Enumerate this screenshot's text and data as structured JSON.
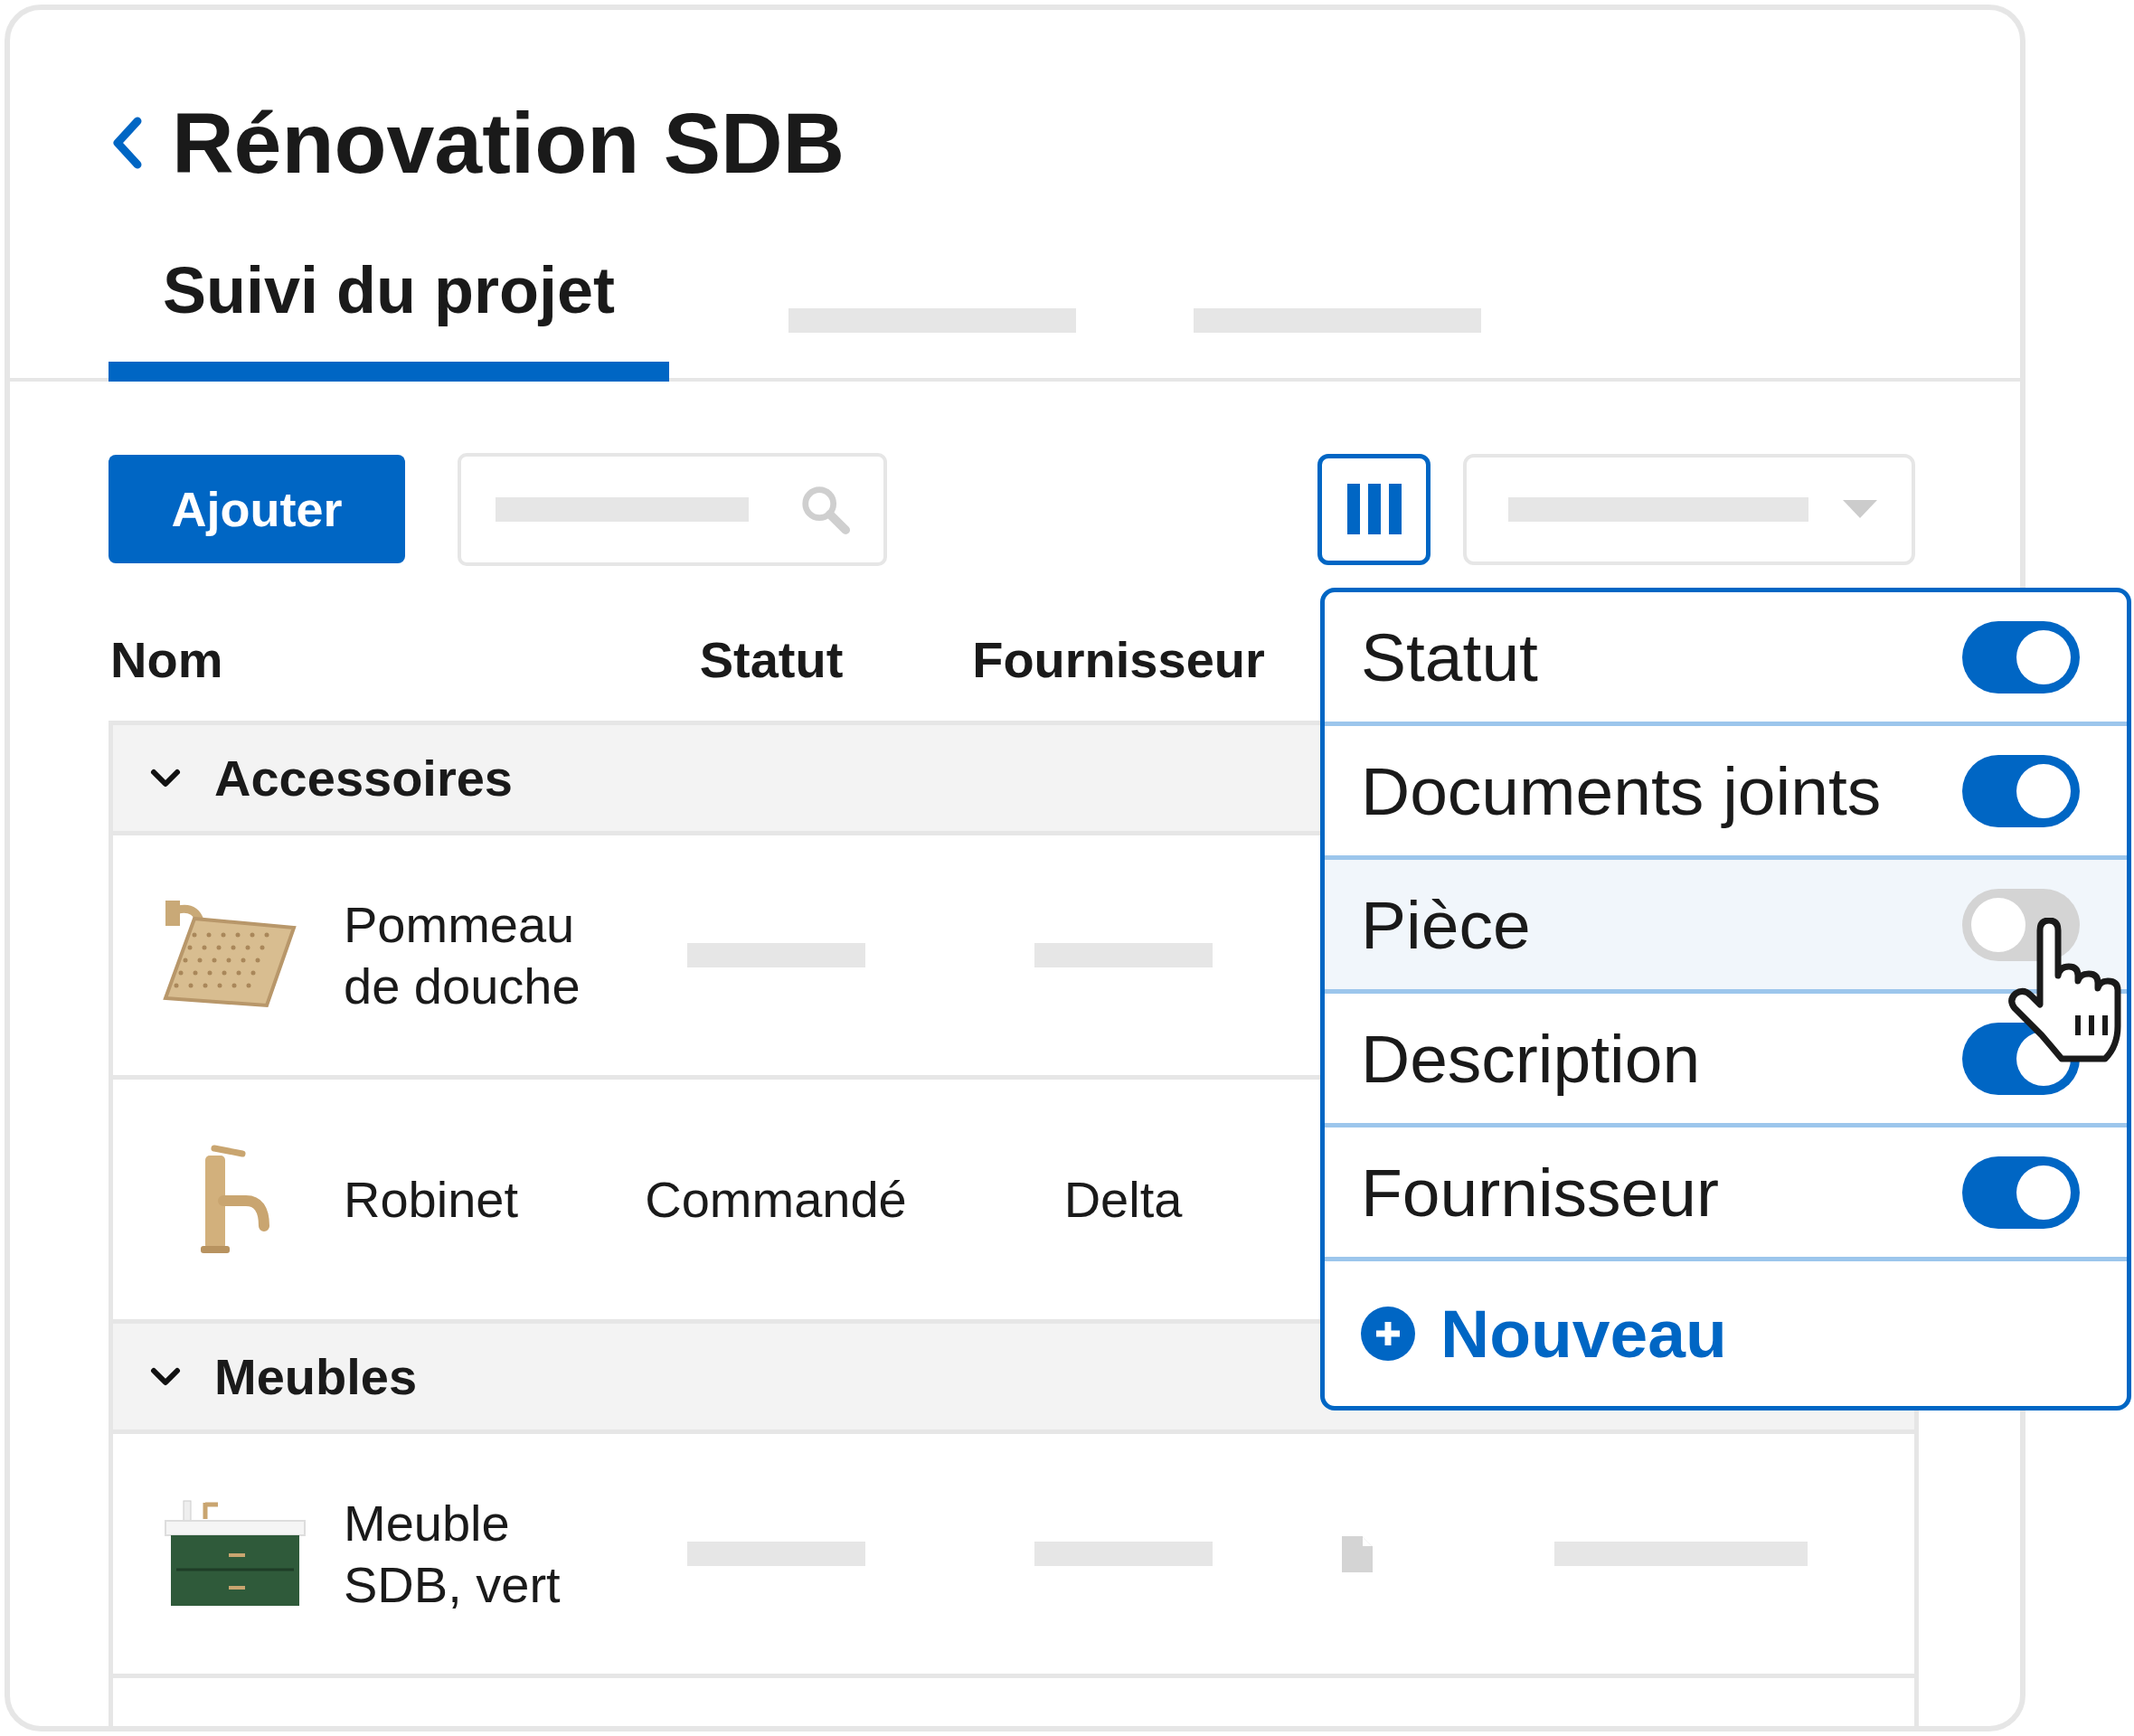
{
  "header": {
    "title": "Rénovation SDB"
  },
  "tabs": [
    {
      "label": "Suivi du projet",
      "selected": true
    }
  ],
  "toolbar": {
    "add_button": "Ajouter"
  },
  "table": {
    "columns": [
      "Nom",
      "Statut",
      "Fournisseur"
    ],
    "groups": [
      {
        "name": "Accessoires",
        "expanded": true,
        "rows": [
          {
            "kind": "shower_head",
            "name": "Pommeau\nde douche"
          },
          {
            "kind": "faucet",
            "name": "Robinet",
            "status": "Commandé",
            "supplier": "Delta"
          }
        ]
      },
      {
        "name": "Meubles",
        "expanded": true,
        "rows": [
          {
            "kind": "vanity",
            "name": "Meuble\nSDB, vert"
          }
        ]
      }
    ]
  },
  "column_menu": {
    "items": [
      {
        "label": "Statut",
        "on": true,
        "hovered": false
      },
      {
        "label": "Documents joints",
        "on": true,
        "hovered": false
      },
      {
        "label": "Pièce",
        "on": false,
        "hovered": true
      },
      {
        "label": "Description",
        "on": true,
        "hovered": false
      },
      {
        "label": "Fournisseur",
        "on": true,
        "hovered": false
      }
    ],
    "add_label": "Nouveau"
  }
}
